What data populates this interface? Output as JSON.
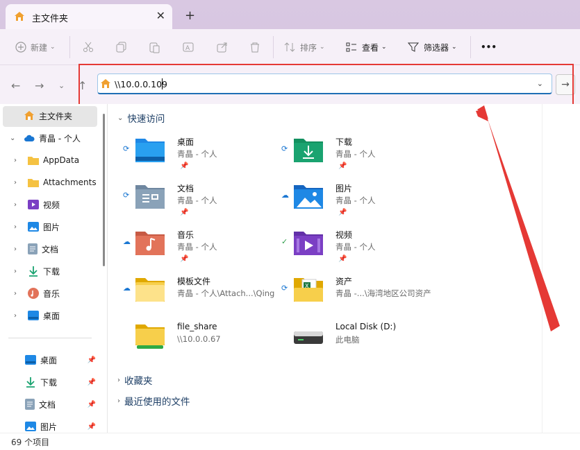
{
  "tab": {
    "title": "主文件夹",
    "close": "✕",
    "new_tab": "+"
  },
  "toolbar": {
    "new_label": "新建",
    "sort_label": "排序",
    "view_label": "查看",
    "filter_label": "筛选器",
    "more_label": "•••"
  },
  "address": {
    "value": "\\\\10.0.0.109"
  },
  "sidebar": {
    "home": "主文件夹",
    "onedrive": "青晶 - 个人",
    "items": [
      {
        "label": "AppData",
        "icon": "folder-icon"
      },
      {
        "label": "Attachments",
        "icon": "folder-icon"
      },
      {
        "label": "视频",
        "icon": "video-icon"
      },
      {
        "label": "图片",
        "icon": "pictures-icon"
      },
      {
        "label": "文档",
        "icon": "documents-icon"
      },
      {
        "label": "下载",
        "icon": "download-icon"
      },
      {
        "label": "音乐",
        "icon": "music-icon"
      },
      {
        "label": "桌面",
        "icon": "desktop-icon"
      }
    ],
    "pinned": [
      {
        "label": "桌面",
        "icon": "desktop-icon"
      },
      {
        "label": "下载",
        "icon": "download-icon"
      },
      {
        "label": "文档",
        "icon": "documents-icon"
      },
      {
        "label": "图片",
        "icon": "pictures-icon"
      }
    ]
  },
  "main": {
    "quick_access": "快速访问",
    "favorites": "收藏夹",
    "recent": "最近使用的文件",
    "items": [
      {
        "name": "桌面",
        "sub": "青晶 - 个人",
        "sync": "sync",
        "icon": "desktop"
      },
      {
        "name": "下载",
        "sub": "青晶 - 个人",
        "sync": "sync",
        "icon": "download"
      },
      {
        "name": "文档",
        "sub": "青晶 - 个人",
        "sync": "sync",
        "icon": "documents"
      },
      {
        "name": "图片",
        "sub": "青晶 - 个人",
        "sync": "cloud",
        "icon": "pictures"
      },
      {
        "name": "音乐",
        "sub": "青晶 - 个人",
        "sync": "cloud",
        "icon": "music"
      },
      {
        "name": "视频",
        "sub": "青晶 - 个人",
        "sync": "check",
        "icon": "video"
      },
      {
        "name": "模板文件",
        "sub": "青晶 - 个人\\Attach...\\Qing",
        "sync": "cloud",
        "icon": "folder"
      },
      {
        "name": "资产",
        "sub": "青晶 -...\\海湾地区公司资产",
        "sync": "sync",
        "icon": "folder-xls"
      },
      {
        "name": "file_share",
        "sub": "\\\\10.0.0.67",
        "sync": "",
        "icon": "network-folder"
      },
      {
        "name": "Local Disk (D:)",
        "sub": "此电脑",
        "sync": "",
        "icon": "disk"
      }
    ]
  },
  "status": {
    "count": "69 个项目"
  },
  "colors": {
    "accent": "#1f6fb5",
    "annotation_red": "#e53935"
  }
}
